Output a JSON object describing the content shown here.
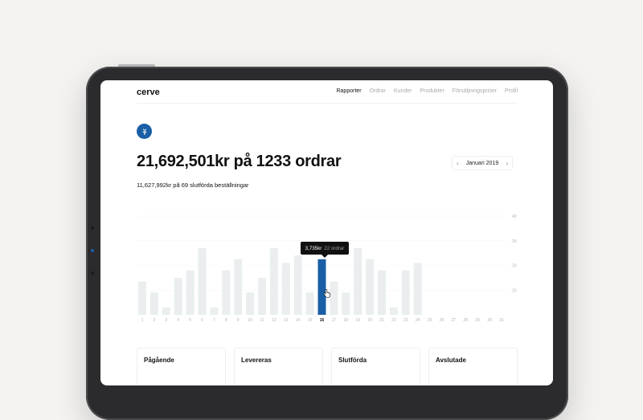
{
  "app": {
    "logo": "cerve"
  },
  "nav": {
    "items": [
      "Rapporter",
      "Ordrar",
      "Kunder",
      "Produkter",
      "Försäljningspriser",
      "Profil"
    ],
    "active": 0
  },
  "badge": {
    "icon": "leaf-icon",
    "color": "#1a5fa6"
  },
  "summary": {
    "headline": "21,692,501kr på 1233 ordrar",
    "subline": "11,627,992kr på 69 slutförda beställningar"
  },
  "month_picker": {
    "label": "Januari 2019",
    "prev_icon": "chevron-left-icon",
    "next_icon": "chevron-right-icon"
  },
  "chart_data": {
    "type": "bar",
    "categories": [
      "1",
      "2",
      "3",
      "4",
      "5",
      "6",
      "7",
      "8",
      "9",
      "10",
      "11",
      "12",
      "13",
      "14",
      "15",
      "16",
      "17",
      "18",
      "19",
      "20",
      "21",
      "22",
      "23",
      "24",
      "25",
      "26",
      "27",
      "28",
      "29",
      "30",
      "31"
    ],
    "values": [
      13.5,
      9,
      3,
      15,
      18,
      27,
      3,
      18,
      22.5,
      9,
      15,
      27,
      21,
      24,
      9,
      22.5,
      13.5,
      9,
      27,
      22.5,
      18,
      3,
      18,
      21,
      0,
      0,
      0,
      0,
      0,
      0,
      0
    ],
    "yticks": [
      "40",
      "30",
      "20",
      "10"
    ],
    "ylim": [
      0,
      40
    ],
    "highlight_index": 15,
    "colors": {
      "bar": "#eaeeee",
      "highlight": "#1a5fa6"
    }
  },
  "tooltip": {
    "amount": "3,735kr",
    "orders": "22 ordrar"
  },
  "cards": [
    "Pågående",
    "Levereras",
    "Slutförda",
    "Avslutade"
  ]
}
